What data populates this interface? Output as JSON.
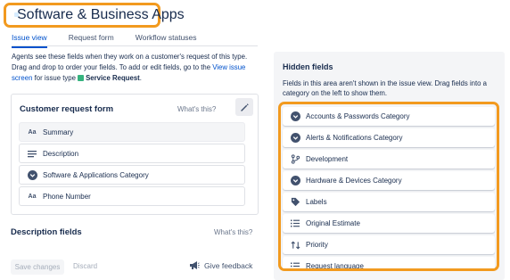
{
  "header": {
    "title": "Software & Business Apps"
  },
  "tabs": [
    {
      "label": "Issue view",
      "active": true
    },
    {
      "label": "Request form",
      "active": false
    },
    {
      "label": "Workflow statuses",
      "active": false
    }
  ],
  "intro": {
    "text_before": "Agents see these fields when they work on a customer's request of this type. Drag and drop to order your fields. To add or edit fields, go to the ",
    "link": "View issue screen",
    "text_after": " for issue type ",
    "issue_type": "Service Request",
    "period": "."
  },
  "customer_form": {
    "title": "Customer request form",
    "whats_this": "What's this?",
    "fields": [
      {
        "label": "Summary",
        "icon": "text-icon",
        "glyph": "Aa",
        "selected": true
      },
      {
        "label": "Description",
        "icon": "paragraph-icon",
        "glyph": "≡",
        "selected": false
      },
      {
        "label": "Software & Applications Category",
        "icon": "chevron-circle-icon",
        "glyph": "⌄",
        "selected": false
      },
      {
        "label": "Phone Number",
        "icon": "text-icon",
        "glyph": "Aa",
        "selected": false
      }
    ]
  },
  "description_fields": {
    "title": "Description fields",
    "whats_this": "What's this?"
  },
  "footer": {
    "save_label": "Save changes",
    "discard_label": "Discard",
    "feedback_label": "Give feedback"
  },
  "hidden_fields": {
    "title": "Hidden fields",
    "description": "Fields in this area aren't shown in the issue view. Drag fields into a category on the left to show them.",
    "fields": [
      {
        "label": "Accounts & Passwords Category",
        "icon": "chevron-circle-icon"
      },
      {
        "label": "Alerts & Notifications Category",
        "icon": "chevron-circle-icon"
      },
      {
        "label": "Development",
        "icon": "branch-icon"
      },
      {
        "label": "Hardware & Devices Category",
        "icon": "chevron-circle-icon"
      },
      {
        "label": "Labels",
        "icon": "tag-icon"
      },
      {
        "label": "Original Estimate",
        "icon": "list-icon"
      },
      {
        "label": "Priority",
        "icon": "priority-icon"
      },
      {
        "label": "Request language",
        "icon": "list-icon"
      }
    ]
  },
  "colors": {
    "highlight": "#f29a1f",
    "link": "#0052cc",
    "accent": "#36b37e"
  }
}
